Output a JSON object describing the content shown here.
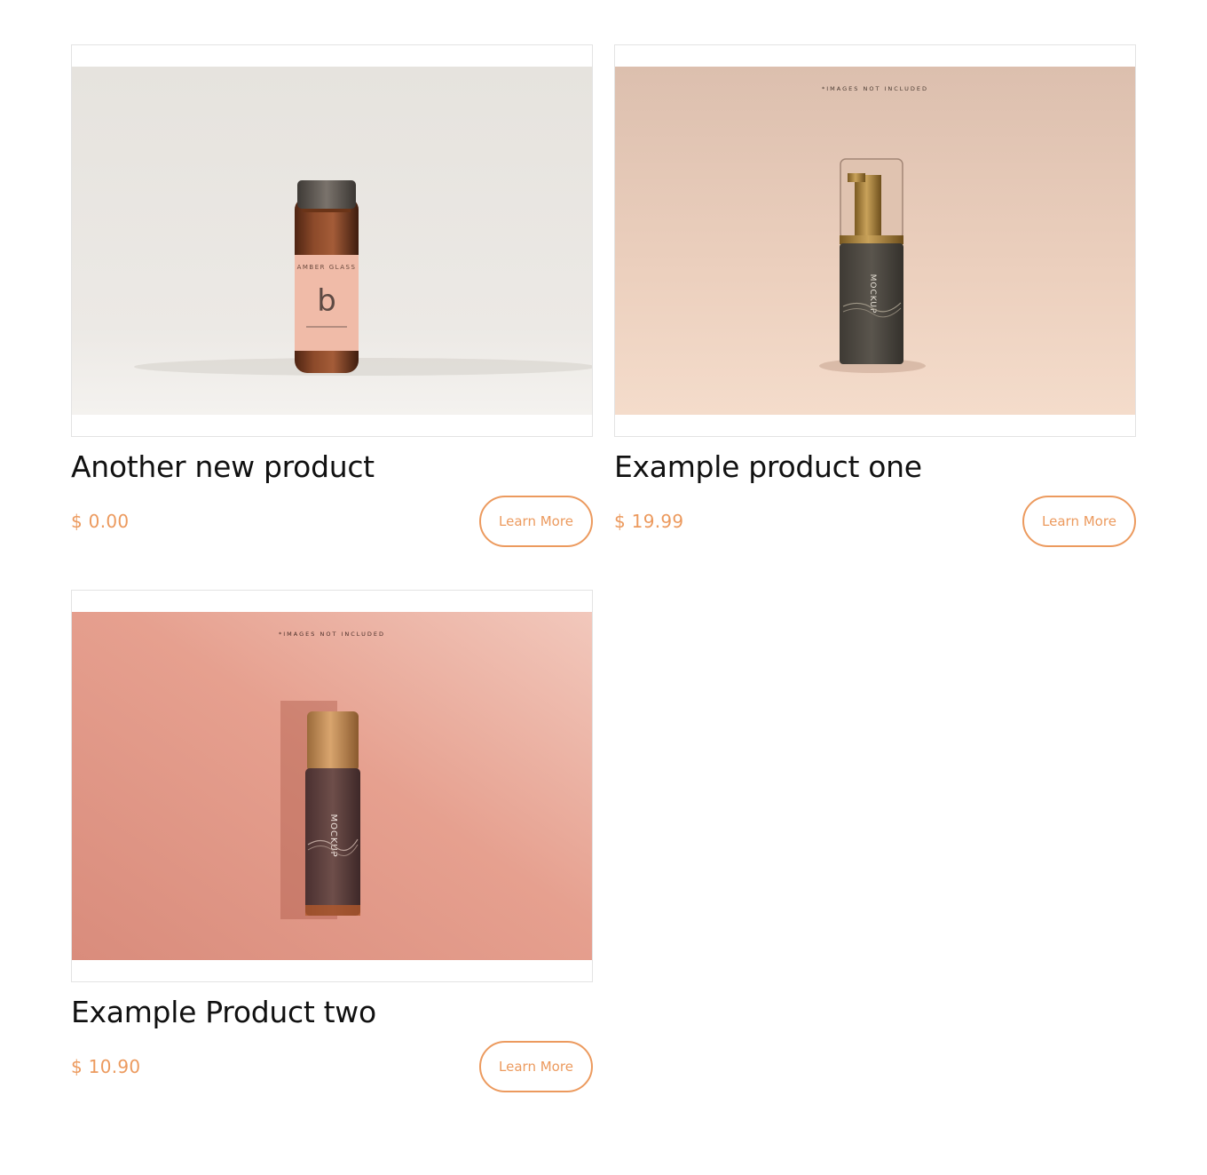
{
  "products": [
    {
      "title": "Another new product",
      "price": "$ 0.00",
      "button_label": "Learn More",
      "image": {
        "icon": "amber-glass-vial-photo",
        "label_letter": "b",
        "label_brand": "AMBER GLASS",
        "background": "#e6e3de"
      }
    },
    {
      "title": "Example product one",
      "price": "$ 19.99",
      "button_label": "Learn More",
      "image": {
        "icon": "pump-bottle-photo",
        "caption": "*IMAGES NOT INCLUDED",
        "label_text": "MOCKUP",
        "background": "#e6c8b6"
      }
    },
    {
      "title": "Example Product two",
      "price": "$ 10.90",
      "button_label": "Learn More",
      "image": {
        "icon": "roller-bottle-photo",
        "caption": "*IMAGES NOT INCLUDED",
        "label_text": "MOCKUP",
        "background": "#e4907f"
      }
    }
  ],
  "colors": {
    "accent": "#ec9a5e",
    "border": "#e3e3e3",
    "title": "#111111"
  }
}
